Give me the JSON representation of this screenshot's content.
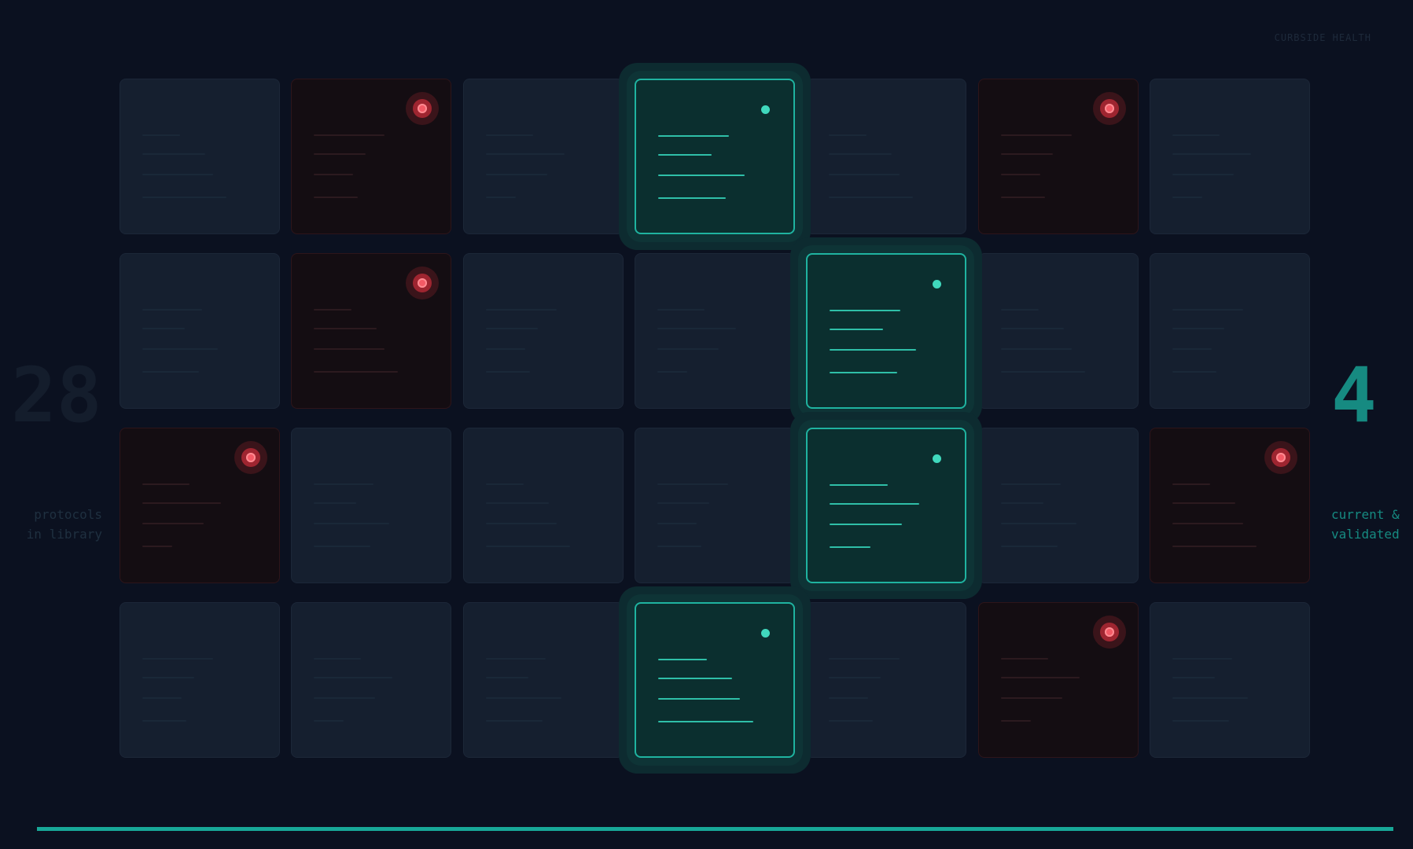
{
  "brand": "CURBSIDE HEALTH",
  "left_stat": {
    "value": "28",
    "label_line1": "protocols",
    "label_line2": "in library"
  },
  "right_stat": {
    "value": "4",
    "label_line1": "current &",
    "label_line2": "validated"
  },
  "progress": {
    "fraction": 1.0
  },
  "colors": {
    "background": "#0b1120",
    "valid_accent": "#1fb3a0",
    "risk_accent": "#f35a66",
    "neutral_card": "#151f2f"
  },
  "icons": {
    "valid_marker": "status-dot-icon",
    "risk_marker": "alert-target-icon"
  },
  "grid": {
    "rows": 4,
    "cols": 7,
    "cells": [
      [
        "neutral",
        "risk",
        "neutral",
        "valid",
        "neutral",
        "risk",
        "neutral"
      ],
      [
        "neutral",
        "risk",
        "neutral",
        "neutral",
        "valid",
        "neutral",
        "neutral"
      ],
      [
        "risk",
        "neutral",
        "neutral",
        "neutral",
        "valid",
        "neutral",
        "risk"
      ],
      [
        "neutral",
        "neutral",
        "neutral",
        "valid",
        "neutral",
        "risk",
        "neutral"
      ]
    ]
  }
}
